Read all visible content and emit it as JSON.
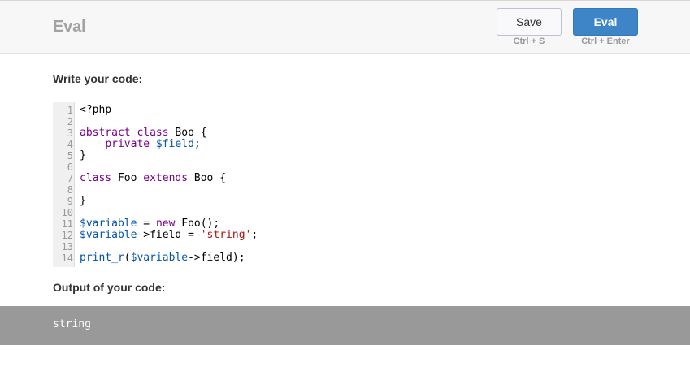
{
  "header": {
    "title": "Eval",
    "save_label": "Save",
    "save_shortcut": "Ctrl + S",
    "eval_label": "Eval",
    "eval_shortcut": "Ctrl + Enter"
  },
  "editor": {
    "label": "Write your code:",
    "lines": [
      {
        "num": "1",
        "tokens": [
          {
            "t": "<?php",
            "c": ""
          }
        ]
      },
      {
        "num": "2",
        "tokens": []
      },
      {
        "num": "3",
        "tokens": [
          {
            "t": "abstract",
            "c": "kw"
          },
          {
            "t": " ",
            "c": ""
          },
          {
            "t": "class",
            "c": "kw"
          },
          {
            "t": " Boo {",
            "c": ""
          }
        ]
      },
      {
        "num": "4",
        "tokens": [
          {
            "t": "    ",
            "c": ""
          },
          {
            "t": "private",
            "c": "kw"
          },
          {
            "t": " ",
            "c": ""
          },
          {
            "t": "$field",
            "c": "var"
          },
          {
            "t": ";",
            "c": ""
          }
        ]
      },
      {
        "num": "5",
        "tokens": [
          {
            "t": "}",
            "c": ""
          }
        ]
      },
      {
        "num": "6",
        "tokens": []
      },
      {
        "num": "7",
        "tokens": [
          {
            "t": "class",
            "c": "kw"
          },
          {
            "t": " Foo ",
            "c": ""
          },
          {
            "t": "extends",
            "c": "kw"
          },
          {
            "t": " Boo {",
            "c": ""
          }
        ]
      },
      {
        "num": "8",
        "tokens": []
      },
      {
        "num": "9",
        "tokens": [
          {
            "t": "}",
            "c": ""
          }
        ]
      },
      {
        "num": "10",
        "tokens": []
      },
      {
        "num": "11",
        "tokens": [
          {
            "t": "$variable",
            "c": "var"
          },
          {
            "t": " = ",
            "c": ""
          },
          {
            "t": "new",
            "c": "kw"
          },
          {
            "t": " Foo();",
            "c": ""
          }
        ]
      },
      {
        "num": "12",
        "tokens": [
          {
            "t": "$variable",
            "c": "var"
          },
          {
            "t": "->field = ",
            "c": ""
          },
          {
            "t": "'string'",
            "c": "str"
          },
          {
            "t": ";",
            "c": ""
          }
        ]
      },
      {
        "num": "13",
        "tokens": []
      },
      {
        "num": "14",
        "tokens": [
          {
            "t": "print_r",
            "c": "var"
          },
          {
            "t": "(",
            "c": ""
          },
          {
            "t": "$variable",
            "c": "var"
          },
          {
            "t": "->field);",
            "c": ""
          }
        ]
      }
    ]
  },
  "output": {
    "label": "Output of your code:",
    "text": "string"
  },
  "colors": {
    "keyword": "#770088",
    "variable": "#0055aa",
    "string": "#aa1111",
    "eval_button": "#3d85c6",
    "output_background": "#999999"
  }
}
